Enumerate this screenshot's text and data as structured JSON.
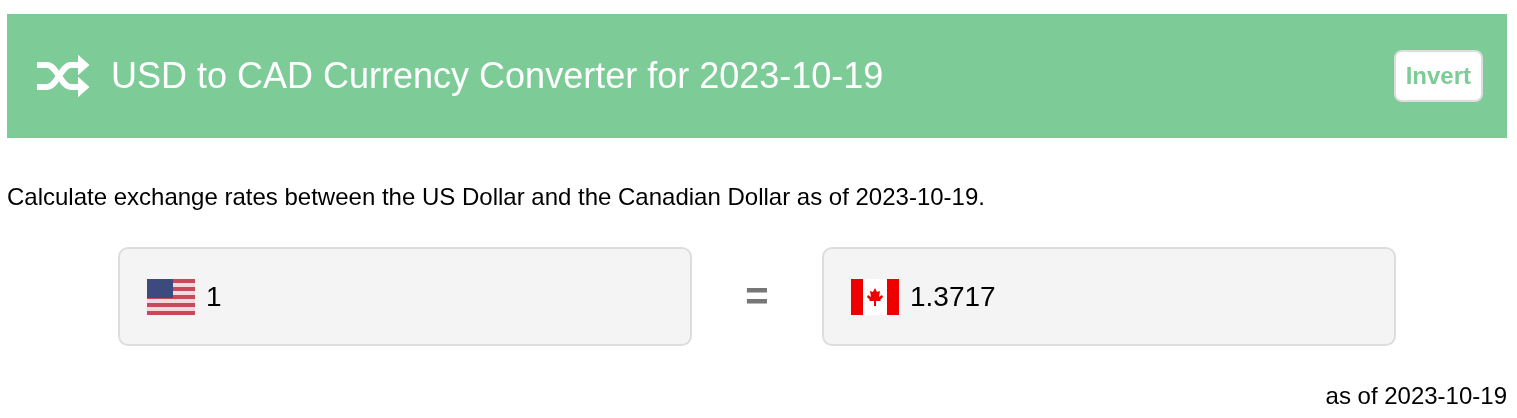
{
  "header": {
    "title": "USD to CAD Currency Converter for 2023-10-19",
    "invert_button": "Invert"
  },
  "description": "Calculate exchange rates between the US Dollar and the Canadian Dollar as of 2023-10-19.",
  "converter": {
    "from": {
      "kind": "us",
      "value": "1"
    },
    "equals": "=",
    "to": {
      "kind": "ca",
      "value": "1.3717"
    }
  },
  "footnote": "as of 2023-10-19"
}
